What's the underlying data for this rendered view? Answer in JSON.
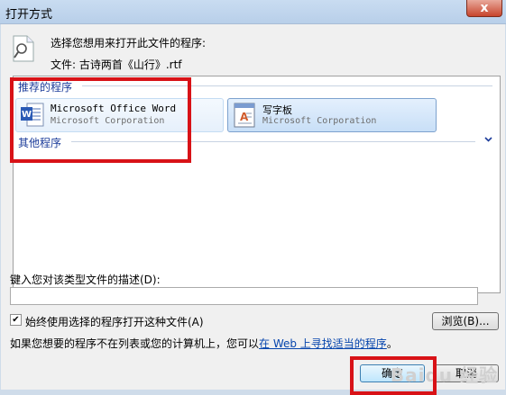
{
  "window": {
    "title": "打开方式",
    "close_label": "x"
  },
  "header": {
    "prompt": "选择您想用来打开此文件的程序:",
    "filename": "文件: 古诗两首《山行》.rtf"
  },
  "recommended": {
    "label": "推荐的程序",
    "programs": [
      {
        "name": "Microsoft Office Word",
        "company": "Microsoft Corporation",
        "icon": "word-icon"
      },
      {
        "name": "写字板",
        "company": "Microsoft Corporation",
        "icon": "wordpad-icon"
      }
    ]
  },
  "other": {
    "label": "其他程序"
  },
  "description": {
    "label": "键入您对该类型文件的描述(D):",
    "value": ""
  },
  "always_use": {
    "label": "始终使用选择的程序打开这种文件(A)",
    "checked": true
  },
  "browse_label": "浏览(B)...",
  "info": {
    "prefix": "如果您想要的程序不在列表或您的计算机上，您可以",
    "link": "在 Web 上寻找适当的程序",
    "suffix": "。"
  },
  "ok_label": "确定",
  "cancel_label": "取消",
  "watermark": "Baidu 经验"
}
